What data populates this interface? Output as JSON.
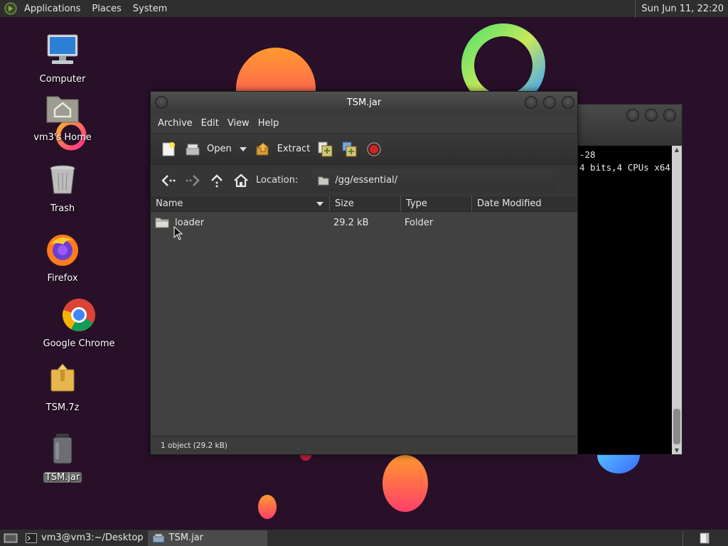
{
  "top_panel": {
    "menus": [
      "Applications",
      "Places",
      "System"
    ],
    "clock": "Sun Jun 11, 22:20"
  },
  "desktop_icons": [
    {
      "label": "Computer",
      "icon": "computer-icon"
    },
    {
      "label": "vm3's Home",
      "icon": "home-folder-icon"
    },
    {
      "label": "Trash",
      "icon": "trash-icon"
    },
    {
      "label": "Firefox",
      "icon": "firefox-icon"
    },
    {
      "label": "Google Chrome",
      "icon": "chrome-icon"
    },
    {
      "label": "TSM.7z",
      "icon": "archive-icon"
    },
    {
      "label": "TSM.jar",
      "icon": "jar-icon",
      "selected": true
    }
  ],
  "terminal": {
    "lines": [
      "-28",
      "4 bits,4 CPUs x64"
    ]
  },
  "archive_window": {
    "title": "TSM.jar",
    "menu": [
      "Archive",
      "Edit",
      "View",
      "Help"
    ],
    "toolbar": {
      "open_label": "Open",
      "extract_label": "Extract"
    },
    "location": {
      "label": "Location:",
      "path": "/gg/essential/"
    },
    "columns": [
      "Name",
      "Size",
      "Type",
      "Date Modified"
    ],
    "rows": [
      {
        "name": "loader",
        "size": "29.2 kB",
        "type": "Folder",
        "date": ""
      }
    ],
    "status": "1 object (29.2 kB)"
  },
  "taskbar": {
    "tasks": [
      {
        "label": "vm3@vm3:~/Desktop",
        "icon": "terminal-icon",
        "active": false
      },
      {
        "label": "TSM.jar",
        "icon": "archive-manager-icon",
        "active": true
      }
    ]
  },
  "colors": {
    "wallpaper": "#2a1030",
    "panel": "#2e2e2e",
    "window_body": "#414141"
  }
}
